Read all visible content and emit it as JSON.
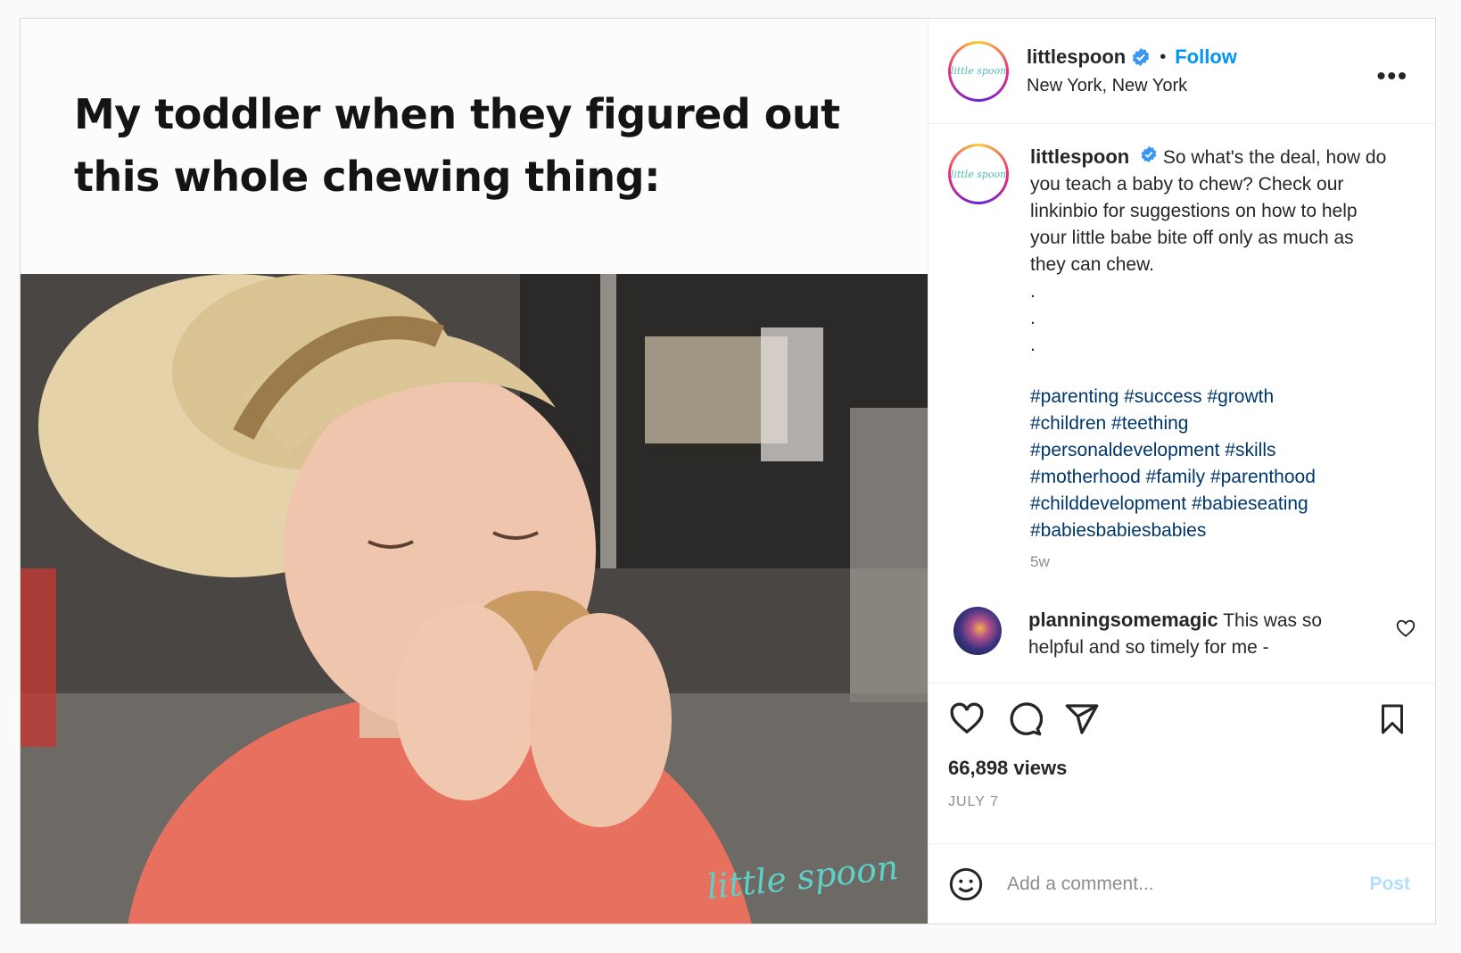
{
  "media": {
    "meme_text": "My toddler when they figured out this whole chewing thing:",
    "watermark": "little spoon"
  },
  "header": {
    "avatar_logo": "little spoon",
    "username": "littlespoon",
    "separator": "•",
    "follow_label": "Follow",
    "location": "New York, New York",
    "more_label": "•••"
  },
  "caption": {
    "username": "littlespoon",
    "text": "So what's the deal, how do you teach a baby to chew? Check our linkinbio for suggestions on how to help your little babe bite off only as much as they can chew.",
    "dots": [
      ".",
      ".",
      "."
    ],
    "hashtags": [
      "#parenting #success #growth",
      "#children #teething",
      "#personaldevelopment #skills",
      "#motherhood #family #parenthood",
      "#childdevelopment #babieseating",
      "#babiesbabiesbabies"
    ],
    "time_ago": "5w"
  },
  "comment": {
    "username": "planningsomemagic",
    "text": "This was so helpful and so timely for me -"
  },
  "actions": {
    "icons": [
      "heart-icon",
      "comment-icon",
      "share-icon",
      "bookmark-icon"
    ],
    "views": "66,898 views",
    "date": "JULY 7"
  },
  "add_comment": {
    "placeholder": "Add a comment...",
    "post_label": "Post"
  },
  "colors": {
    "link_blue": "#0095f6",
    "hashtag": "#00376b",
    "muted": "#8e8e8e",
    "post_disabled": "#b2dffc",
    "watermark": "#5fd0c8"
  }
}
